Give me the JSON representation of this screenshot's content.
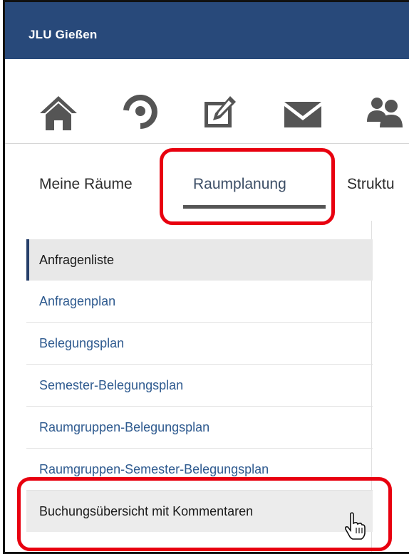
{
  "header": {
    "title": "JLU Gießen"
  },
  "toolbar_icons": [
    "home-icon",
    "spinner-icon",
    "edit-icon",
    "mail-icon",
    "users-icon"
  ],
  "tabs": [
    {
      "label": "Meine Räume"
    },
    {
      "label": "Raumplanung",
      "active": true
    },
    {
      "label": "Struktu"
    }
  ],
  "menu": [
    {
      "label": "Anfragenliste",
      "state": "selected"
    },
    {
      "label": "Anfragenplan"
    },
    {
      "label": "Belegungsplan"
    },
    {
      "label": "Semester-Belegungsplan"
    },
    {
      "label": "Raumgruppen-Belegungsplan"
    },
    {
      "label": "Raumgruppen-Semester-Belegungsplan"
    },
    {
      "label": "Buchungsübersicht mit Kommentaren",
      "state": "hover"
    }
  ],
  "colors": {
    "header_bg": "#28497a",
    "highlight": "#e8000f",
    "link": "#2e5a8f"
  }
}
